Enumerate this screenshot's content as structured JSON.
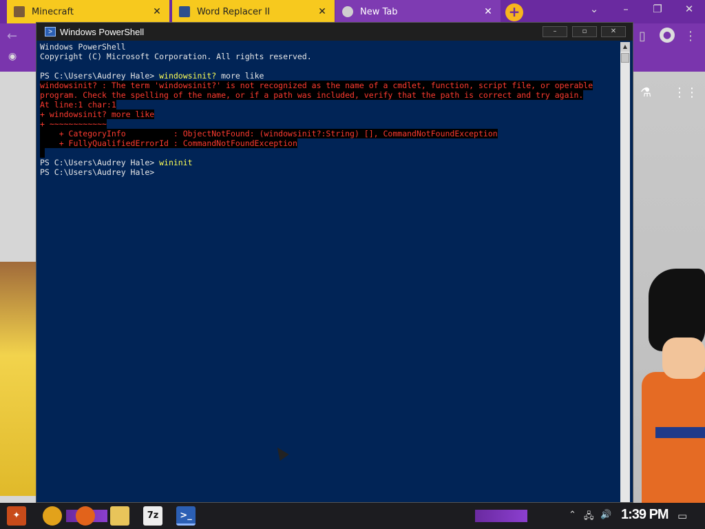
{
  "browser": {
    "tabs": [
      {
        "label": "Minecraft",
        "icon": "minecraft-icon",
        "color": "#f7c91e"
      },
      {
        "label": "Word Replacer II",
        "icon": "word-replacer-icon",
        "color": "#f7c91e"
      },
      {
        "label": "New Tab",
        "icon": "chrome-icon",
        "color": "#7e3bb2"
      }
    ],
    "new_tab_glyph": "+",
    "accent": "#6a2aa0"
  },
  "powershell": {
    "title": "Windows PowerShell",
    "background": "#012456",
    "lines": [
      {
        "type": "out",
        "text": "Windows PowerShell"
      },
      {
        "type": "out",
        "text": "Copyright (C) Microsoft Corporation. All rights reserved."
      },
      {
        "type": "out",
        "text": ""
      },
      {
        "type": "prompt",
        "prompt": "PS C:\\Users\\Audrey Hale> ",
        "cmd": "windowsinit?",
        "args": " more like"
      },
      {
        "type": "err",
        "text": "windowsinit? : The term 'windowsinit?' is not recognized as the name of a cmdlet, function, script file, or operable"
      },
      {
        "type": "err",
        "text": "program. Check the spelling of the name, or if a path was included, verify that the path is correct and try again."
      },
      {
        "type": "err",
        "text": "At line:1 char:1"
      },
      {
        "type": "err",
        "text": "+ windowsinit? more like"
      },
      {
        "type": "err",
        "text": "+ ~~~~~~~~~~~~"
      },
      {
        "type": "err",
        "text": "    + CategoryInfo          : ObjectNotFound: (windowsinit?:String) [], CommandNotFoundException"
      },
      {
        "type": "err",
        "text": "    + FullyQualifiedErrorId : CommandNotFoundException"
      },
      {
        "type": "err",
        "text": " "
      },
      {
        "type": "prompt",
        "prompt": "PS C:\\Users\\Audrey Hale> ",
        "cmd": "wininit",
        "args": ""
      },
      {
        "type": "out",
        "text": "PS C:\\Users\\Audrey Hale>"
      }
    ]
  },
  "taskbar": {
    "clock": "1:39 PM",
    "items": [
      {
        "name": "start-button",
        "glyph": "✦"
      },
      {
        "name": "chrome",
        "glyph": "●"
      },
      {
        "name": "firefox",
        "glyph": "●"
      },
      {
        "name": "file-explorer",
        "glyph": "▬"
      },
      {
        "name": "7zip",
        "glyph": "7z"
      },
      {
        "name": "powershell",
        "glyph": ">_"
      }
    ]
  }
}
